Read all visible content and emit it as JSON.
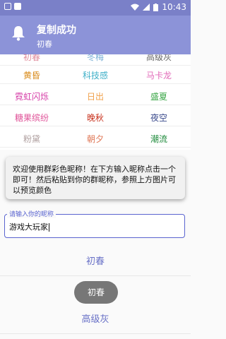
{
  "status_bar": {
    "time": "10:43",
    "icons": [
      "notification-box-icon",
      "square-icon",
      "wifi-icon",
      "signal-icon",
      "battery-icon"
    ]
  },
  "notification": {
    "icon": "bell-icon",
    "title": "复制成功",
    "subtitle": "初春"
  },
  "grid": {
    "rows": [
      [
        {
          "text": "初春",
          "color": "#e08a9a"
        },
        {
          "text": "冬梅",
          "color": "#7ab0d6"
        },
        {
          "text": "高级灰",
          "color": "#666666"
        }
      ],
      [
        {
          "text": "黄昏",
          "color": "#d98c1d"
        },
        {
          "text": "科技感",
          "color": "#3fb0c8"
        },
        {
          "text": "马卡龙",
          "color": "#e26ab8"
        }
      ],
      [
        {
          "text": "霓虹闪烁",
          "color": "#d63fa8"
        },
        {
          "text": "日出",
          "color": "#f0a04a"
        },
        {
          "text": "盛夏",
          "color": "#3da84a"
        }
      ],
      [
        {
          "text": "糖果缤纷",
          "color": "#e0559a"
        },
        {
          "text": "晚秋",
          "color": "#c8321e"
        },
        {
          "text": "夜空",
          "color": "#3a4a8c"
        }
      ],
      [
        {
          "text": "粉黛",
          "color": "#b0a0a0"
        },
        {
          "text": "朝夕",
          "color": "#e07a5a"
        },
        {
          "text": "潮流",
          "color": "#1d8a3a"
        }
      ]
    ]
  },
  "dialog": {
    "message": "欢迎使用群彩色昵称！在下方输入昵称点击一个即可！然后粘贴到你的群昵称，参照上方图片可以预览颜色"
  },
  "input": {
    "label": "请输入你的昵称",
    "value": "游戏大玩家"
  },
  "list": {
    "items": [
      "初春",
      "高级灰"
    ]
  },
  "toast": {
    "text": "初春"
  },
  "colors": {
    "accent": "#5a64d0",
    "status_bar": "#7a80c8",
    "notification_bg": "#8c93d8",
    "list_text": "#6a72c7"
  }
}
